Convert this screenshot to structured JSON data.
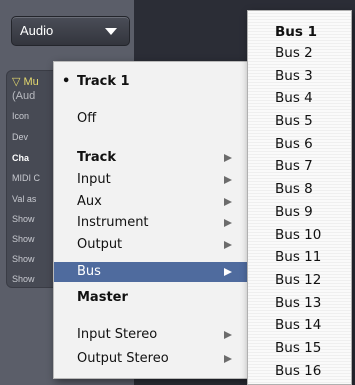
{
  "audio_select": {
    "value": "Audio"
  },
  "inspector": {
    "header": "▽ Mu",
    "sub": "(Aud",
    "rows": [
      "Icon",
      "Dev",
      "Cha",
      "MIDI C",
      "Val as",
      "Show",
      "Show",
      "Show",
      "Show"
    ]
  },
  "menu": {
    "items": [
      {
        "label": "Track 1",
        "checked": "•"
      },
      {
        "label": "Off"
      },
      {
        "label": "Track"
      },
      {
        "label": "Input"
      },
      {
        "label": "Aux"
      },
      {
        "label": "Instrument"
      },
      {
        "label": "Output"
      },
      {
        "label": "Bus"
      },
      {
        "label": "Master"
      },
      {
        "label": "Input Stereo"
      },
      {
        "label": "Output Stereo"
      }
    ]
  },
  "submenu": {
    "items": [
      "Bus 1",
      "Bus 2",
      "Bus 3",
      "Bus 4",
      "Bus 5",
      "Bus 6",
      "Bus 7",
      "Bus 8",
      "Bus 9",
      "Bus 10",
      "Bus 11",
      "Bus 12",
      "Bus 13",
      "Bus 14",
      "Bus 15",
      "Bus 16"
    ]
  },
  "colors": {
    "highlight": "#4f6b9e",
    "menu_bg": "#f2f2f2",
    "panel_bg": "#5b5e69"
  }
}
